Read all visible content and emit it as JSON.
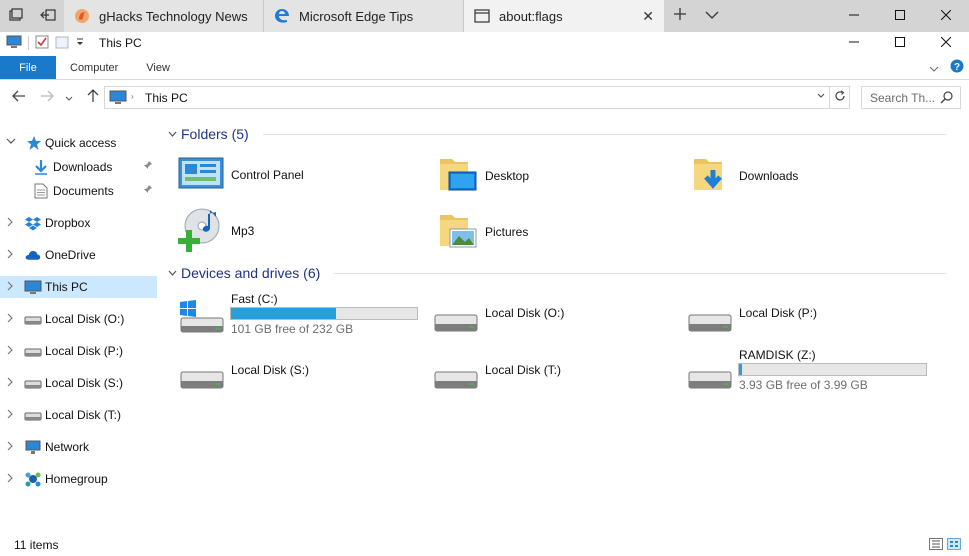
{
  "browser": {
    "tabs": [
      {
        "title": "gHacks Technology News",
        "active": false
      },
      {
        "title": "Microsoft Edge Tips",
        "active": false
      },
      {
        "title": "about:flags",
        "active": true
      }
    ]
  },
  "explorer": {
    "window_title": "This PC",
    "ribbon_tabs": [
      "File",
      "Computer",
      "View"
    ],
    "breadcrumb": "This PC",
    "search_placeholder": "Search Th...",
    "nav": {
      "quick_access": "Quick access",
      "downloads": "Downloads",
      "documents": "Documents",
      "dropbox": "Dropbox",
      "onedrive": "OneDrive",
      "this_pc": "This PC",
      "disk_o": "Local Disk (O:)",
      "disk_p": "Local Disk (P:)",
      "disk_s": "Local Disk (S:)",
      "disk_t": "Local Disk (T:)",
      "network": "Network",
      "homegroup": "Homegroup"
    },
    "folders_heading": "Folders (5)",
    "folders": {
      "control_panel": "Control Panel",
      "desktop": "Desktop",
      "downloads": "Downloads",
      "mp3": "Mp3",
      "pictures": "Pictures"
    },
    "devices_heading": "Devices and drives (6)",
    "drives": {
      "c": {
        "name": "Fast (C:)",
        "free": "101 GB free of 232 GB",
        "used_fraction": 0.565
      },
      "o": {
        "name": "Local Disk (O:)"
      },
      "p": {
        "name": "Local Disk (P:)"
      },
      "s": {
        "name": "Local Disk (S:)"
      },
      "t": {
        "name": "Local Disk (T:)"
      },
      "z": {
        "name": "RAMDISK (Z:)",
        "free": "3.93 GB free of 3.99 GB",
        "used_fraction": 0.015
      }
    },
    "status_count": "11 items"
  }
}
